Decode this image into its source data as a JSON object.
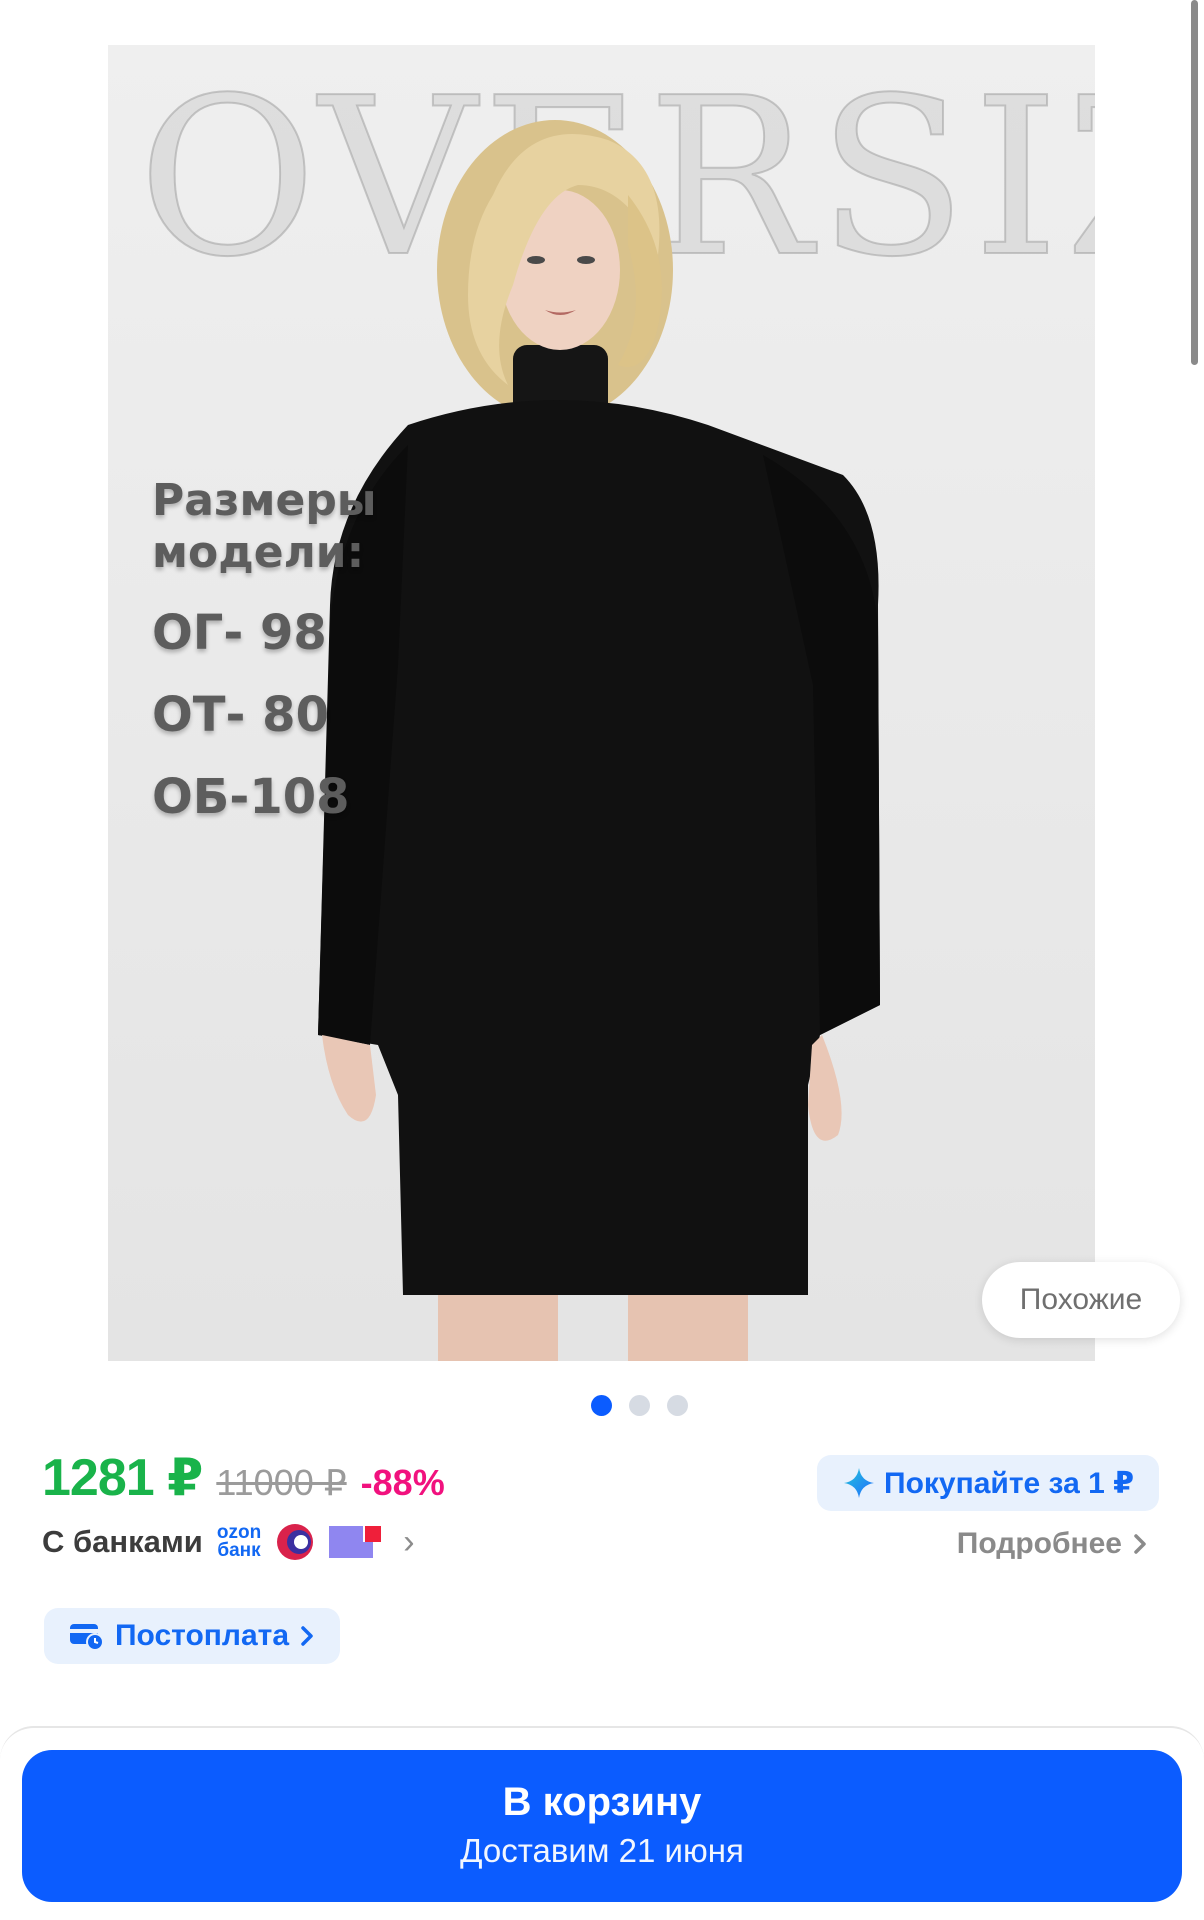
{
  "product_image": {
    "watermark_text": "OVERSIZE",
    "sizes_heading": "Размеры модели:",
    "measurements": [
      "ОГ- 98",
      "ОТ- 80",
      "ОБ-108"
    ]
  },
  "similar_button": {
    "label": "Похожие"
  },
  "gallery": {
    "total": 3,
    "active_index": 0
  },
  "price": {
    "current": "1281 ₽",
    "old": "11000 ₽",
    "discount": "-88%"
  },
  "promo": {
    "buy_for_label": "Покупайте за 1 ₽"
  },
  "banks": {
    "label": "С банками",
    "ozon_logo_top": "ozon",
    "ozon_logo_bottom": "банк",
    "icons": [
      "ozon-bank-icon",
      "card-bank-icon",
      "flag-bank-icon"
    ]
  },
  "details_link": {
    "label": "Подробнее"
  },
  "postpay": {
    "label": "Постоплата"
  },
  "cart_button": {
    "label": "В корзину",
    "delivery": "Доставим 21 июня"
  },
  "colors": {
    "accent": "#0b5cff",
    "price_green": "#19b34a",
    "discount_pink": "#f1117e",
    "chip_bg": "#e8f1fd"
  }
}
